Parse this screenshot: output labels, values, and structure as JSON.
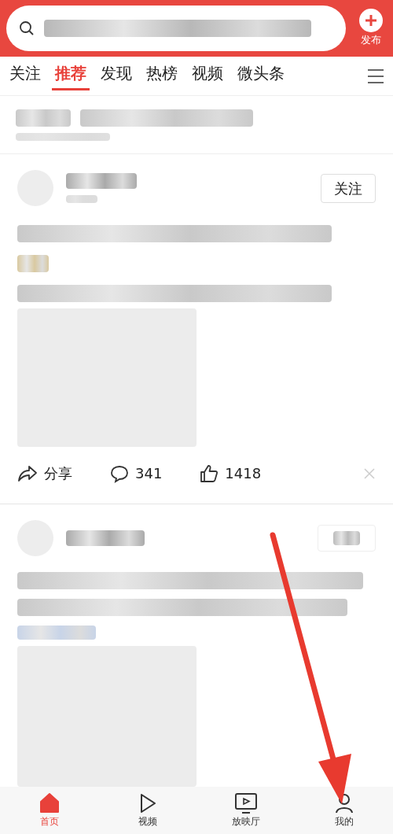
{
  "header": {
    "publish_label": "发布"
  },
  "tabs": [
    {
      "label": "关注",
      "selected": false
    },
    {
      "label": "推荐",
      "selected": true
    },
    {
      "label": "发现",
      "selected": false
    },
    {
      "label": "热榜",
      "selected": false
    },
    {
      "label": "视频",
      "selected": false
    },
    {
      "label": "微头条",
      "selected": false
    }
  ],
  "post": {
    "follow_label": "关注",
    "share_label": "分享",
    "comments": "341",
    "likes": "1418"
  },
  "nav": [
    {
      "label": "首页",
      "selected": true,
      "kind": "home"
    },
    {
      "label": "视频",
      "selected": false,
      "kind": "video"
    },
    {
      "label": "放映厅",
      "selected": false,
      "kind": "tv"
    },
    {
      "label": "我的",
      "selected": false,
      "kind": "user"
    }
  ]
}
